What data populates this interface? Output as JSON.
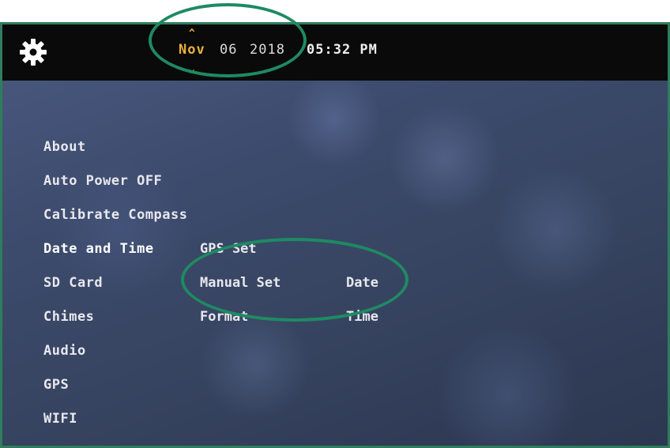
{
  "header": {
    "month": "Nov",
    "day": "06",
    "year": "2018",
    "time": "05:32 PM",
    "up_arrow": "^",
    "down_arrow": "⌄"
  },
  "menu": {
    "items": [
      {
        "label": "About"
      },
      {
        "label": "Auto Power OFF"
      },
      {
        "label": "Calibrate Compass"
      },
      {
        "label": "Date and Time"
      },
      {
        "label": "SD Card"
      },
      {
        "label": "Chimes"
      },
      {
        "label": "Audio"
      },
      {
        "label": "GPS"
      },
      {
        "label": "WIFI"
      }
    ]
  },
  "submenu": {
    "date_time_options": [
      "GPS Set",
      "Manual Set",
      "Format"
    ],
    "manual_fields": [
      "Date",
      "Time"
    ]
  },
  "colors": {
    "accent_month": "#e9b23a",
    "annotation_oval": "#1e8a62",
    "frame_border": "#2f7d5c"
  },
  "icons": [
    "gear-icon",
    "chevron-up-icon",
    "chevron-down-icon"
  ]
}
